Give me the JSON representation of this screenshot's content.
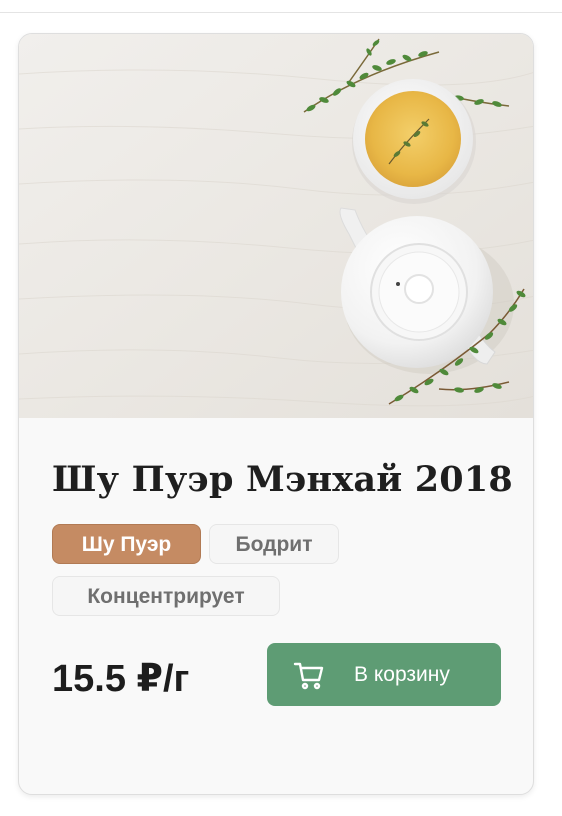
{
  "product": {
    "title": "Шу Пуэр Мэнхай 2018",
    "image_alt": "white teapot and cup of tea with thyme sprigs on a light wooden table",
    "tags": [
      {
        "label": "Шу Пуэр",
        "style": "primary"
      },
      {
        "label": "Бодрит",
        "style": "secondary"
      },
      {
        "label": "Концентрирует",
        "style": "secondary"
      }
    ],
    "price": "15.5 ₽/г",
    "add_to_cart_label": "В корзину",
    "cart_icon": "shopping-cart-icon"
  },
  "colors": {
    "accent_green": "#5e9c74",
    "tag_primary": "#c58b63",
    "card_bg": "#f9f9f9"
  }
}
